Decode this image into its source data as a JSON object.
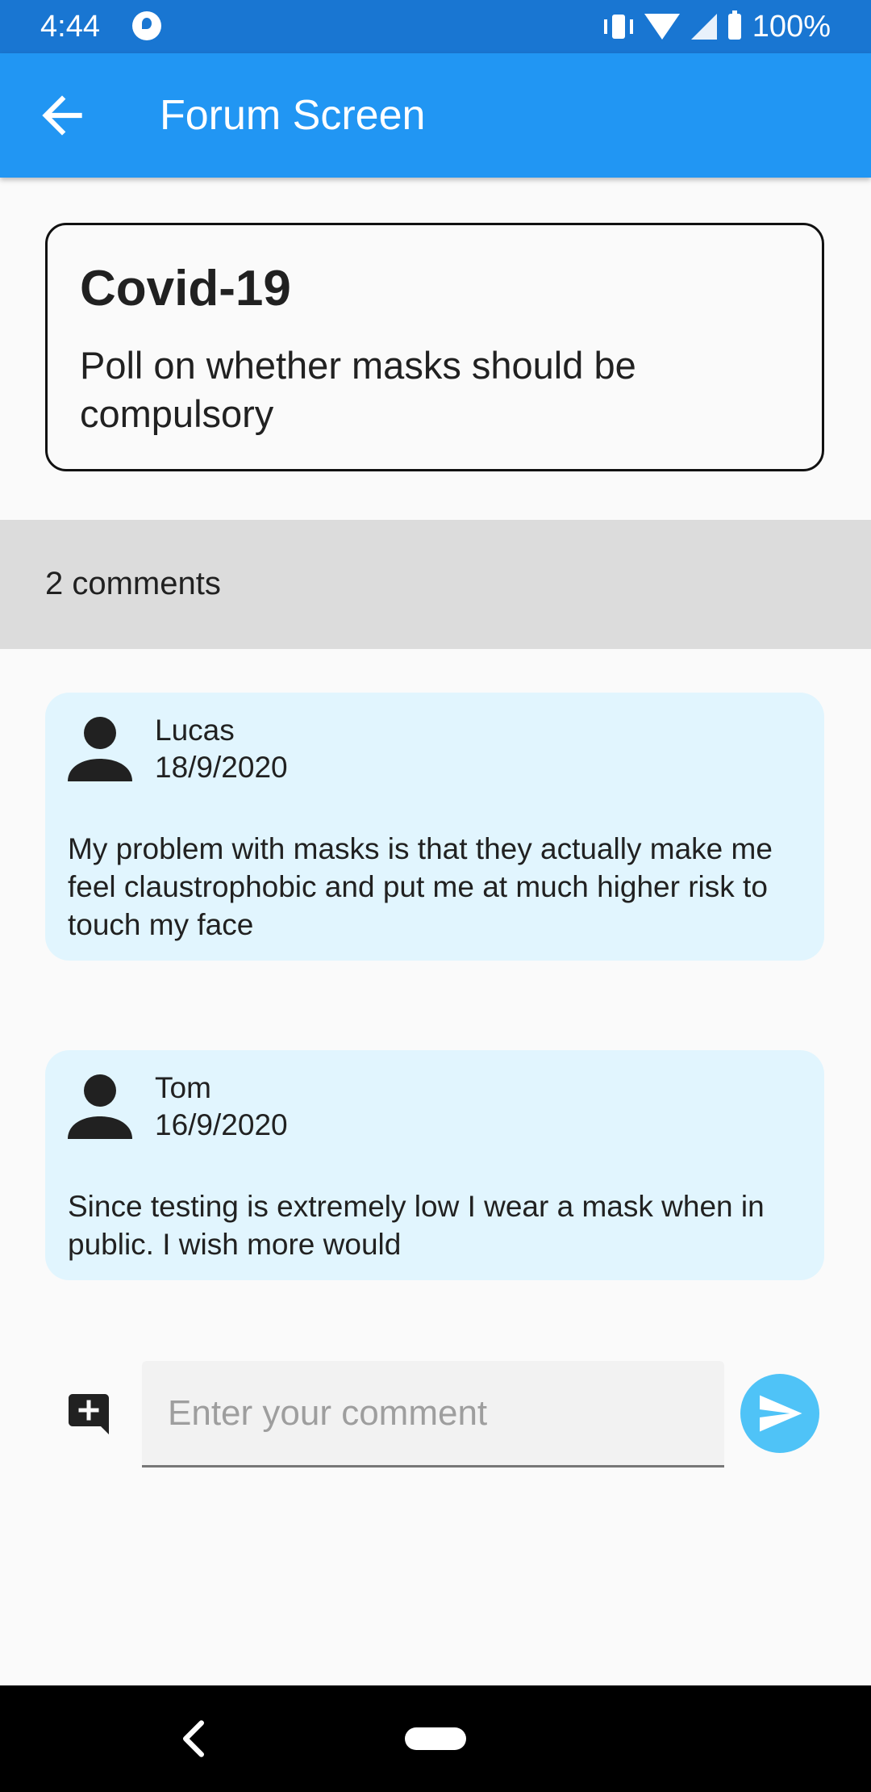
{
  "status_bar": {
    "time": "4:44",
    "battery_text": "100%",
    "icons": [
      "app-notification-icon",
      "vibrate-icon",
      "wifi-icon",
      "signal-icon",
      "battery-icon"
    ]
  },
  "app_bar": {
    "title": "Forum Screen",
    "back_icon": "arrow-back-icon",
    "background": "#2196f3"
  },
  "post": {
    "title": "Covid-19",
    "description": "Poll on whether masks should be compulsory"
  },
  "comments_count": "2 comments",
  "comments": [
    {
      "author": "Lucas",
      "date": "18/9/2020",
      "text": "My problem with masks is that they actually make me feel claustrophobic and put me at much higher risk to touch my face",
      "avatar_icon": "person-icon"
    },
    {
      "author": "Tom",
      "date": "16/9/2020",
      "text": "Since testing is extremely low I wear a mask when in public. I wish more would",
      "avatar_icon": "person-icon"
    }
  ],
  "comment_input": {
    "placeholder": "Enter your comment",
    "value": "",
    "add_icon": "add-comment-icon",
    "send_icon": "send-icon"
  },
  "colors": {
    "status_bar": "#1976d2",
    "app_bar": "#2196f3",
    "comment_card": "#e1f5fe",
    "comments_bar": "#dcdcdc",
    "send_button": "#4fc3f7"
  }
}
